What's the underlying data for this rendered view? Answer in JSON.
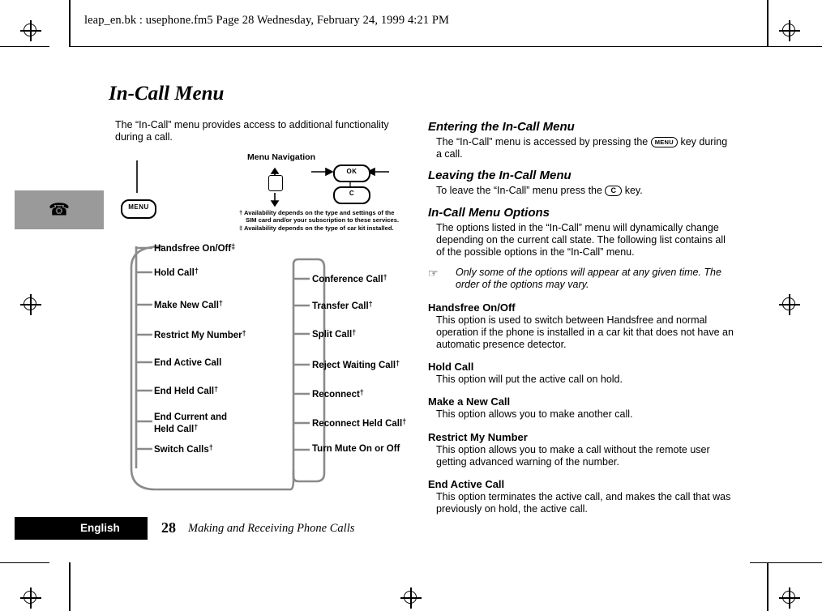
{
  "header": {
    "text": "leap_en.bk : usephone.fm5  Page 28  Wednesday, February 24, 1999  4:21 PM"
  },
  "chapter": {
    "title": "In-Call Menu"
  },
  "intro": {
    "text": "The “In-Call” menu provides access to additional functionality during a call."
  },
  "diagram": {
    "nav_title": "Menu Navigation",
    "menu_key_label": "MENU",
    "ok_key_label": "OK",
    "c_key_label": "C",
    "footnote_1": "† Availability depends on the type and settings of the",
    "footnote_2": "SIM card and/or your subscription to these services.",
    "footnote_3": "‡ Availability depends on the type of car kit installed.",
    "left_items": [
      {
        "label": "Handsfree On/Off",
        "mark": "‡"
      },
      {
        "label": "Hold Call",
        "mark": "†"
      },
      {
        "label": "Make New Call",
        "mark": "†"
      },
      {
        "label": "Restrict My Number",
        "mark": "†"
      },
      {
        "label": "End Active Call",
        "mark": ""
      },
      {
        "label": "End Held Call",
        "mark": "†"
      },
      {
        "label": "End Current and",
        "mark": ""
      },
      {
        "label": "Held Call",
        "mark": "†"
      },
      {
        "label": "Switch Calls",
        "mark": "†"
      }
    ],
    "right_items": [
      {
        "label": "Conference Call",
        "mark": "†"
      },
      {
        "label": "Transfer Call",
        "mark": "†"
      },
      {
        "label": "Split Call",
        "mark": "†"
      },
      {
        "label": "Reject Waiting Call",
        "mark": "†"
      },
      {
        "label": "Reconnect",
        "mark": "†"
      },
      {
        "label": "Reconnect Held Call",
        "mark": "†"
      },
      {
        "label": "Turn Mute On or Off",
        "mark": ""
      }
    ]
  },
  "right_column": {
    "entering": {
      "heading": "Entering the In-Call Menu",
      "text_before": "The “In-Call” menu is accessed by pressing the ",
      "key": "MENU",
      "text_after": " key during a call."
    },
    "leaving": {
      "heading": "Leaving the In-Call Menu",
      "text_before": "To leave the “In-Call” menu press the ",
      "key": "C",
      "text_after": " key."
    },
    "options": {
      "heading": "In-Call Menu Options",
      "text": "The options listed in the “In-Call” menu will dynamically change depending on the current call state. The following list contains all of the possible options in the “In-Call” menu.",
      "note": "Only some of the options will appear at any given time. The order of the options may vary."
    },
    "entries": [
      {
        "heading": "Handsfree On/Off",
        "text": "This option is used to switch between Handsfree and normal operation if the phone is installed in a car kit that does not have an automatic presence detector."
      },
      {
        "heading": "Hold Call",
        "text": "This option will put the active call on hold."
      },
      {
        "heading": "Make a New Call",
        "text": "This option allows you to make another call."
      },
      {
        "heading": "Restrict My Number",
        "text": "This option allows you to make a call without the remote user getting advanced warning of the number."
      },
      {
        "heading": "End Active Call",
        "text": "This option terminates the active call, and makes the call that was previously on hold, the active call."
      }
    ]
  },
  "footer": {
    "language": "English",
    "page_number": "28",
    "section_title": "Making and Receiving Phone Calls"
  }
}
